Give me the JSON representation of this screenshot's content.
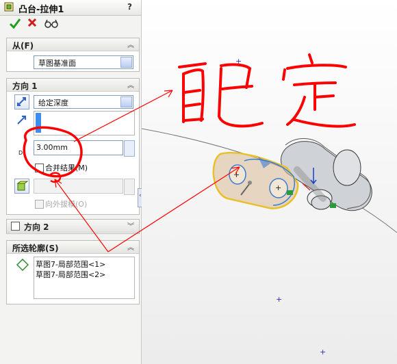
{
  "feature": {
    "title": "凸台-拉伸1",
    "help": "?"
  },
  "toolbar": {
    "ok": "ok-check-icon",
    "cancel": "cancel-x-icon",
    "preview": "preview-glasses-icon"
  },
  "from_section": {
    "title": "从(F)",
    "start_condition": "草图基准面"
  },
  "direction1": {
    "title": "方向 1",
    "end_condition": "给定深度",
    "depth_label": "D1",
    "depth": "3.00mm",
    "merge_result": "合并结果(M)",
    "draft_outward": "向外拔模(O)"
  },
  "direction2": {
    "title": "方向 2"
  },
  "contours": {
    "title": "所选轮廓(S)",
    "items": [
      "草图7-局部范围<1>",
      "草图7-局部范围<2>"
    ]
  },
  "annotation": {
    "handwriting": "自己定",
    "color": "#ff0000"
  },
  "colors": {
    "accent": "#2f5fd0",
    "highlight": "#e8c02a",
    "selection": "#3a7bd5",
    "check": "#1e9e1e",
    "cross": "#d11a1a"
  }
}
